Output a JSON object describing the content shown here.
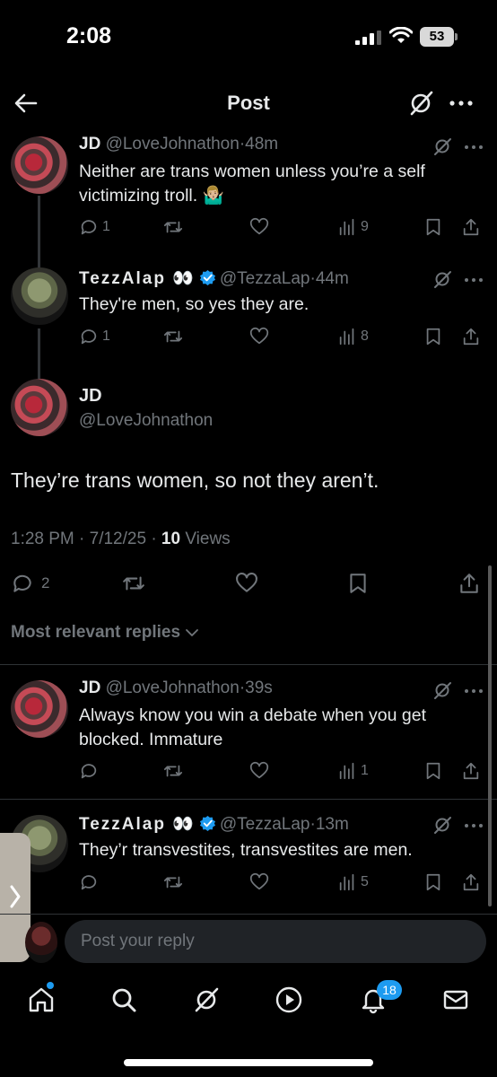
{
  "status_bar": {
    "time": "2:08",
    "battery": "53"
  },
  "header": {
    "title": "Post"
  },
  "thread": [
    {
      "name": "JD",
      "handle": "@LoveJohnathon",
      "time": "48m",
      "text": "Neither are trans women unless you’re a self victimizing troll. 🤷🏼‍♂️",
      "replies": "1",
      "views": "9"
    },
    {
      "name": "TezzAlap 👀",
      "handle": "@TezzaLap",
      "time": "44m",
      "text": "They're men, so yes they are.",
      "replies": "1",
      "views": "8"
    }
  ],
  "main_post": {
    "name": "JD",
    "handle": "@LoveJohnathon",
    "text": "They’re trans women, so not they aren’t.",
    "timestamp": "1:28 PM · 7/12/25 · ",
    "views_count": "10",
    "views_label": " Views",
    "replies": "2"
  },
  "replies_filter": {
    "label": "Most relevant replies"
  },
  "replies": [
    {
      "name": "JD",
      "handle": "@LoveJohnathon",
      "time": "39s",
      "text": "Always know you win a debate when you get blocked. Immature",
      "views": "1"
    },
    {
      "name": "TezzAlap 👀",
      "handle": "@TezzaLap",
      "time": "13m",
      "text": "They’r transvestites, transvestites are men.",
      "views": "5"
    }
  ],
  "reply_box": {
    "placeholder": "Post your reply"
  },
  "tab_bar": {
    "notifications_count": "18"
  },
  "colors": {
    "accent": "#1d9bf0",
    "muted": "#71767b",
    "text": "#e7e9ea",
    "background": "#000000"
  }
}
